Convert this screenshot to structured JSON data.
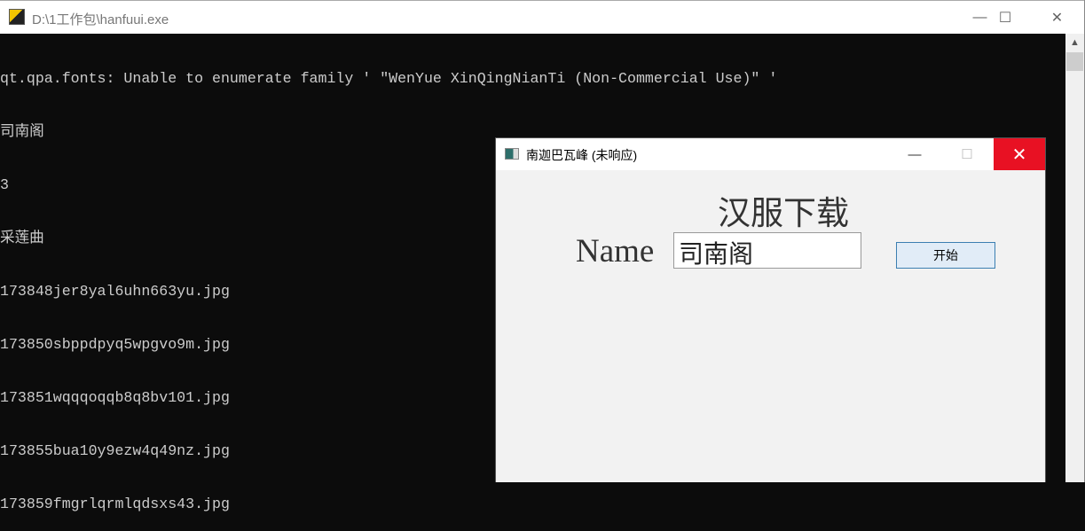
{
  "console": {
    "title": "D:\\1工作包\\hanfuui.exe",
    "minimize": "—",
    "maximize": "☐",
    "close": "✕",
    "lines": [
      "qt.qpa.fonts: Unable to enumerate family ' \"WenYue XinQingNianTi (Non-Commercial Use)\" '",
      "司南阁",
      "3",
      "采莲曲",
      "173848jer8yal6uhn663yu.jpg",
      "173850sbppdpyq5wpgvo9m.jpg",
      "173851wqqqoqqb8q8bv101.jpg",
      "173855bua10y9ezw4q49nz.jpg",
      "173859fmgrlqrmlqdsxs43.jpg"
    ]
  },
  "dialog": {
    "title": "南迦巴瓦峰 (未响应)",
    "minimize": "—",
    "maximize": "☐",
    "close": "✕",
    "heading": "汉服下载",
    "name_label": "Name",
    "name_value": "司南阁",
    "start_button": "开始"
  }
}
